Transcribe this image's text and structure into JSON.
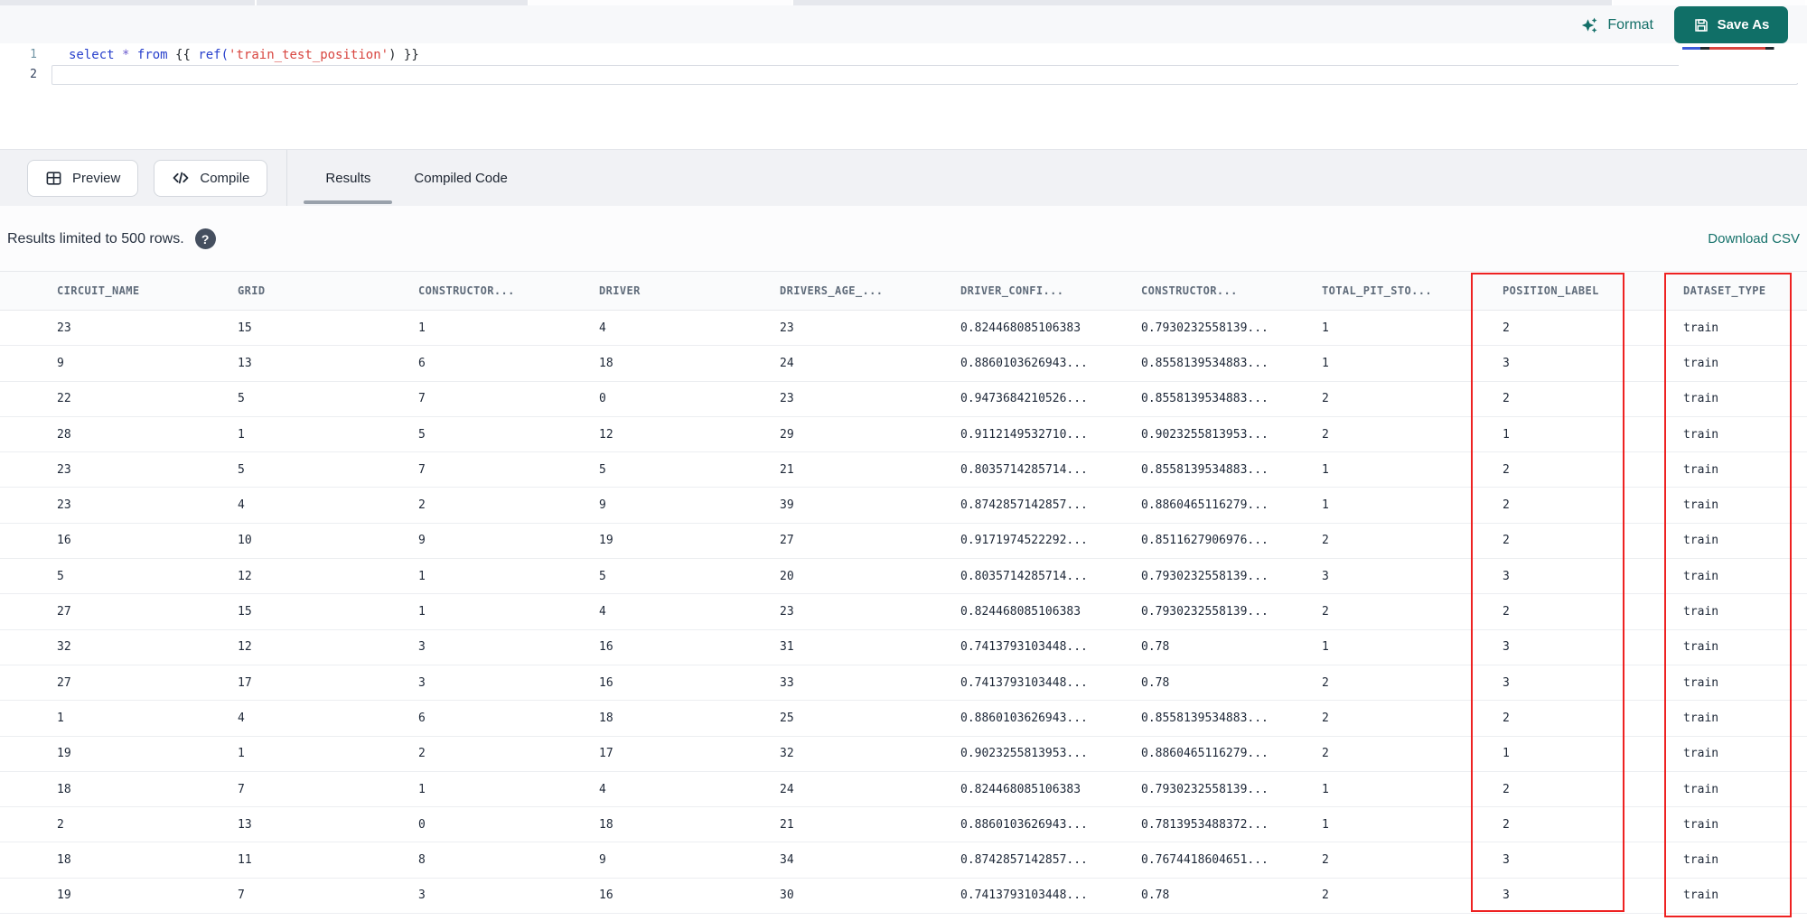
{
  "toolbar": {
    "format_label": "Format",
    "save_as_label": "Save As"
  },
  "editor": {
    "lines": [
      {
        "number": "1",
        "tokens": [
          {
            "text": "select",
            "type": "keyword"
          },
          {
            "text": " ",
            "type": "plain"
          },
          {
            "text": "*",
            "type": "operator"
          },
          {
            "text": " ",
            "type": "plain"
          },
          {
            "text": "from",
            "type": "keyword"
          },
          {
            "text": " {{ ",
            "type": "plain"
          },
          {
            "text": "ref(",
            "type": "function"
          },
          {
            "text": "'train_test_position'",
            "type": "string"
          },
          {
            "text": ") }}",
            "type": "plain"
          }
        ]
      },
      {
        "number": "2",
        "tokens": []
      }
    ]
  },
  "actions": {
    "preview_label": "Preview",
    "compile_label": "Compile"
  },
  "tabs": [
    {
      "label": "Results",
      "active": true
    },
    {
      "label": "Compiled Code",
      "active": false
    }
  ],
  "results_bar": {
    "limit_text": "Results limited to 500 rows.",
    "help_glyph": "?",
    "download_label": "Download CSV"
  },
  "table": {
    "headers": [
      "CIRCUIT_NAME",
      "GRID",
      "CONSTRUCTOR...",
      "DRIVER",
      "DRIVERS_AGE_...",
      "DRIVER_CONFI...",
      "CONSTRUCTOR...",
      "TOTAL_PIT_STO...",
      "POSITION_LABEL",
      "DATASET_TYPE"
    ],
    "rows": [
      [
        "23",
        "15",
        "1",
        "4",
        "23",
        "0.824468085106383",
        "0.7930232558139...",
        "1",
        "2",
        "train"
      ],
      [
        "9",
        "13",
        "6",
        "18",
        "24",
        "0.8860103626943...",
        "0.8558139534883...",
        "1",
        "3",
        "train"
      ],
      [
        "22",
        "5",
        "7",
        "0",
        "23",
        "0.9473684210526...",
        "0.8558139534883...",
        "2",
        "2",
        "train"
      ],
      [
        "28",
        "1",
        "5",
        "12",
        "29",
        "0.9112149532710...",
        "0.9023255813953...",
        "2",
        "1",
        "train"
      ],
      [
        "23",
        "5",
        "7",
        "5",
        "21",
        "0.8035714285714...",
        "0.8558139534883...",
        "1",
        "2",
        "train"
      ],
      [
        "23",
        "4",
        "2",
        "9",
        "39",
        "0.8742857142857...",
        "0.8860465116279...",
        "1",
        "2",
        "train"
      ],
      [
        "16",
        "10",
        "9",
        "19",
        "27",
        "0.9171974522292...",
        "0.8511627906976...",
        "2",
        "2",
        "train"
      ],
      [
        "5",
        "12",
        "1",
        "5",
        "20",
        "0.8035714285714...",
        "0.7930232558139...",
        "3",
        "3",
        "train"
      ],
      [
        "27",
        "15",
        "1",
        "4",
        "23",
        "0.824468085106383",
        "0.7930232558139...",
        "2",
        "2",
        "train"
      ],
      [
        "32",
        "12",
        "3",
        "16",
        "31",
        "0.7413793103448...",
        "0.78",
        "1",
        "3",
        "train"
      ],
      [
        "27",
        "17",
        "3",
        "16",
        "33",
        "0.7413793103448...",
        "0.78",
        "2",
        "3",
        "train"
      ],
      [
        "1",
        "4",
        "6",
        "18",
        "25",
        "0.8860103626943...",
        "0.8558139534883...",
        "2",
        "2",
        "train"
      ],
      [
        "19",
        "1",
        "2",
        "17",
        "32",
        "0.9023255813953...",
        "0.8860465116279...",
        "2",
        "1",
        "train"
      ],
      [
        "18",
        "7",
        "1",
        "4",
        "24",
        "0.824468085106383",
        "0.7930232558139...",
        "1",
        "2",
        "train"
      ],
      [
        "2",
        "13",
        "0",
        "18",
        "21",
        "0.8860103626943...",
        "0.7813953488372...",
        "1",
        "2",
        "train"
      ],
      [
        "18",
        "11",
        "8",
        "9",
        "34",
        "0.8742857142857...",
        "0.7674418604651...",
        "2",
        "3",
        "train"
      ],
      [
        "19",
        "7",
        "3",
        "16",
        "30",
        "0.7413793103448...",
        "0.78",
        "2",
        "3",
        "train"
      ]
    ]
  },
  "annotations": {
    "highlight_color": "#ee2222",
    "highlighted_columns": [
      "POSITION_LABEL",
      "DATASET_TYPE"
    ]
  },
  "colors": {
    "accent_teal": "#106f67",
    "code_keyword": "#2840cc",
    "code_string": "#d8453f"
  }
}
